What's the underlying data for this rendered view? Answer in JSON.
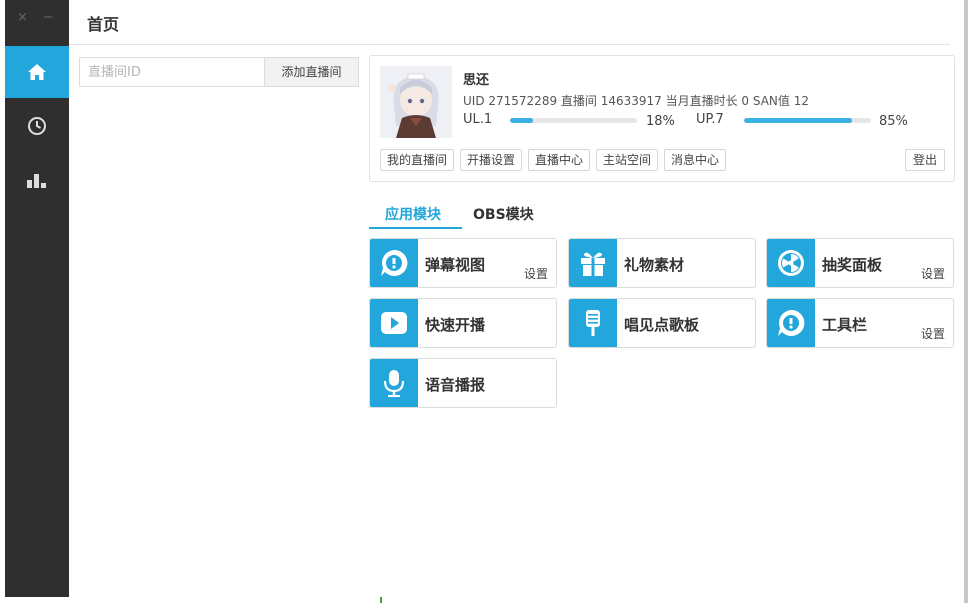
{
  "window": {
    "close_glyph": "×",
    "minimize_glyph": "−"
  },
  "header": {
    "title": "首页"
  },
  "sidebar": {
    "items": [
      {
        "name": "home-icon",
        "active": true
      },
      {
        "name": "clock-icon",
        "active": false
      },
      {
        "name": "bar-chart-icon",
        "active": false
      }
    ]
  },
  "room": {
    "placeholder": "直播间ID",
    "add_label": "添加直播间"
  },
  "user": {
    "name": "思还",
    "info": "UID 271572289 直播间 14633917 当月直播时长 0 SAN值 12",
    "ul_label": "UL.1",
    "ul_percent": 18,
    "ul_percent_text": "18%",
    "up_label": "UP.7",
    "up_percent": 85,
    "up_percent_text": "85%",
    "buttons": [
      "我的直播间",
      "开播设置",
      "直播中心",
      "主站空间",
      "消息中心"
    ],
    "logout_label": "登出"
  },
  "tabs": [
    {
      "label": "应用模块",
      "active": true
    },
    {
      "label": "OBS模块",
      "active": false
    }
  ],
  "modules": [
    {
      "label": "弹幕视图",
      "icon": "chat-bubble-icon",
      "settings": "设置"
    },
    {
      "label": "礼物素材",
      "icon": "gift-icon",
      "settings": ""
    },
    {
      "label": "抽奖面板",
      "icon": "lottery-wheel-icon",
      "settings": "设置"
    },
    {
      "label": "快速开播",
      "icon": "play-icon",
      "settings": ""
    },
    {
      "label": "唱见点歌板",
      "icon": "microphone-stand-icon",
      "settings": ""
    },
    {
      "label": "工具栏",
      "icon": "chat-bubble-icon",
      "settings": "设置"
    },
    {
      "label": "语音播报",
      "icon": "microphone-icon",
      "settings": ""
    }
  ],
  "colors": {
    "accent": "#23a6dc",
    "sidebar": "#2f2f2f"
  }
}
